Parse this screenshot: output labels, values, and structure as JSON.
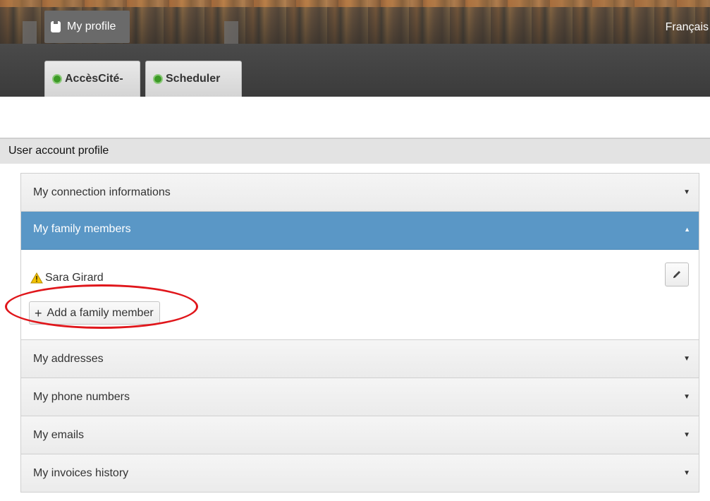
{
  "header": {
    "profile_label": "My profile",
    "language_label": "Français",
    "tabs": [
      {
        "label": "AccèsCité-",
        "status_color": "#3c9a26"
      },
      {
        "label": "Scheduler",
        "status_color": "#3c9a26"
      }
    ]
  },
  "section": {
    "title": "User account profile"
  },
  "accordion": {
    "items": [
      {
        "label": "My connection informations",
        "expanded": false,
        "arrow": "▼"
      },
      {
        "label": "My family members",
        "expanded": true,
        "arrow": "▲"
      },
      {
        "label": "My addresses",
        "expanded": false,
        "arrow": "▼"
      },
      {
        "label": "My phone numbers",
        "expanded": false,
        "arrow": "▼"
      },
      {
        "label": "My emails",
        "expanded": false,
        "arrow": "▼"
      },
      {
        "label": "My invoices history",
        "expanded": false,
        "arrow": "▼"
      }
    ]
  },
  "family": {
    "members": [
      {
        "name": "Sara Girard",
        "status_icon": "warning-icon",
        "action_icon": "pencil-icon"
      }
    ],
    "add_label": "Add a family member",
    "add_icon": "+"
  },
  "colors": {
    "active_header": "#5a97c6",
    "annotation": "#e0161b",
    "warning": "#f2c200"
  }
}
